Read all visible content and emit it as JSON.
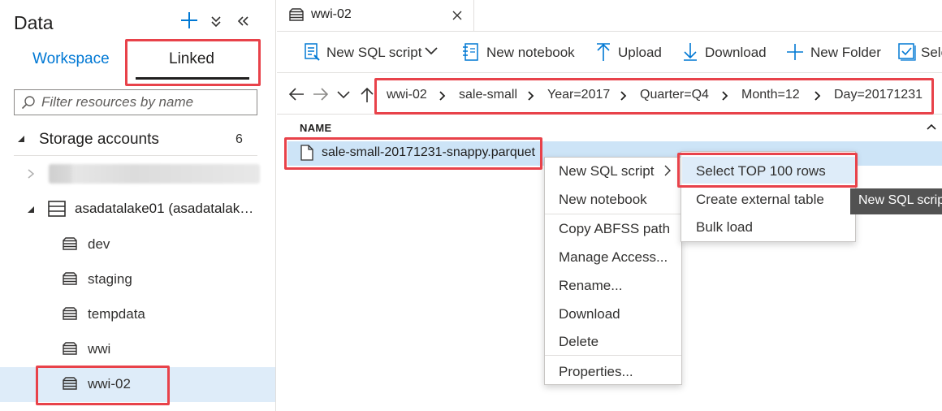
{
  "left_panel": {
    "title": "Data",
    "tabs": {
      "workspace": "Workspace",
      "linked": "Linked"
    },
    "search_placeholder": "Filter resources by name",
    "storage_section": {
      "label": "Storage accounts",
      "count": "6"
    },
    "account": {
      "label": "asadatalake01 (asadatalak…"
    },
    "containers": [
      "dev",
      "staging",
      "tempdata",
      "wwi",
      "wwi-02"
    ]
  },
  "editor": {
    "tab_label": "wwi-02",
    "toolbar": {
      "new_sql_script": "New SQL script",
      "new_notebook": "New notebook",
      "upload": "Upload",
      "download": "Download",
      "new_folder": "New Folder",
      "select_partial": "Sele"
    },
    "breadcrumb": [
      "wwi-02",
      "sale-small",
      "Year=2017",
      "Quarter=Q4",
      "Month=12",
      "Day=20171231"
    ],
    "column_header": "NAME",
    "file_name": "sale-small-20171231-snappy.parquet"
  },
  "context_menu": {
    "items": [
      "New SQL script",
      "New notebook",
      "Copy ABFSS path",
      "Manage Access...",
      "Rename...",
      "Download",
      "Delete",
      "Properties..."
    ]
  },
  "submenu": {
    "items": [
      "Select TOP 100 rows",
      "Create external table",
      "Bulk load"
    ]
  },
  "tooltip": "New SQL scrip",
  "colors": {
    "accent": "#0078d4",
    "highlight_box": "#e8424a",
    "selected_row": "#cde4f7",
    "hover": "#deecf9"
  }
}
